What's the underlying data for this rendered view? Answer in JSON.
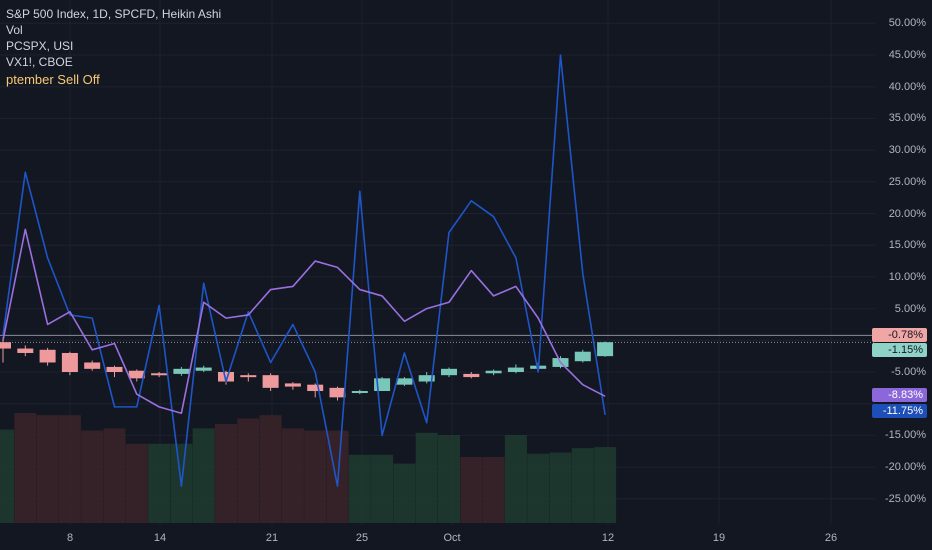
{
  "legend": {
    "title": "S&P 500 Index, 1D, SPCFD, Heikin Ashi",
    "vol": "Vol",
    "pcspx": "PCSPX, USI",
    "vx": "VX1!, CBOE",
    "annotation": "ptember Sell Off"
  },
  "colors": {
    "background": "#131722",
    "grid": "#1e2230",
    "up": "#79c7b9",
    "down": "#ee9a9c",
    "vx_line": "#1e55c8",
    "pcspx_line": "#9a6fe0",
    "pill_spx": "#f1a6a6",
    "pill_spx2": "#8fd3c6",
    "pill_pcspx": "#8b67d9",
    "pill_vx": "#1d4fb8"
  },
  "chart_data": {
    "type": "line",
    "x_labels": [
      "8",
      "14",
      "21",
      "25",
      "Oct",
      "12",
      "19",
      "26"
    ],
    "y_ticks": [
      "50.00%",
      "45.00%",
      "40.00%",
      "35.00%",
      "30.00%",
      "25.00%",
      "20.00%",
      "15.00%",
      "10.00%",
      "5.00%",
      "-5.00%",
      "-15.00%",
      "-20.00%",
      "-25.00%"
    ],
    "y_range": [
      -28,
      52
    ],
    "vx1_cboe": [
      0.8,
      26.5,
      13,
      4,
      3.5,
      -10.5,
      -10.5,
      5.5,
      -23,
      9,
      -6.5,
      4.5,
      -3.5,
      2.5,
      -5,
      -23,
      23.5,
      -15,
      -2,
      -13,
      17,
      22,
      19.5,
      13,
      -5,
      45,
      10.5,
      -11.75
    ],
    "pcspx_usi": [
      0,
      17.5,
      2.5,
      4.5,
      -1.5,
      -0.5,
      -8.5,
      -10.5,
      -11.5,
      6,
      3.5,
      4,
      8,
      8.5,
      12.5,
      11.5,
      8,
      7,
      3,
      5,
      6,
      11,
      7,
      8.5,
      3.5,
      -3.5,
      -7,
      -8.83
    ],
    "spx_candles": [
      {
        "o": -0.3,
        "c": -1.3,
        "h": 0.5,
        "l": -3.5
      },
      {
        "o": -1.3,
        "c": -2.0,
        "h": -0.8,
        "l": -2.5
      },
      {
        "o": -1.5,
        "c": -3.5,
        "h": -1.2,
        "l": -4.0
      },
      {
        "o": -2.0,
        "c": -5.0,
        "h": -1.8,
        "l": -5.5
      },
      {
        "o": -3.5,
        "c": -4.5,
        "h": -3.2,
        "l": -4.8
      },
      {
        "o": -4.2,
        "c": -5.0,
        "h": -4.0,
        "l": -5.8
      },
      {
        "o": -4.8,
        "c": -6.0,
        "h": -4.6,
        "l": -6.5
      },
      {
        "o": -5.2,
        "c": -5.5,
        "h": -5.0,
        "l": -5.8
      },
      {
        "o": -5.3,
        "c": -4.5,
        "h": -4.2,
        "l": -5.6
      },
      {
        "o": -4.8,
        "c": -4.3,
        "h": -4.0,
        "l": -5.0
      },
      {
        "o": -5.0,
        "c": -6.5,
        "h": -4.8,
        "l": -7.0
      },
      {
        "o": -5.5,
        "c": -5.8,
        "h": -5.2,
        "l": -6.5
      },
      {
        "o": -5.5,
        "c": -7.5,
        "h": -5.2,
        "l": -8.0
      },
      {
        "o": -6.8,
        "c": -7.3,
        "h": -6.6,
        "l": -7.8
      },
      {
        "o": -7.0,
        "c": -8.0,
        "h": -6.8,
        "l": -9.0
      },
      {
        "o": -7.5,
        "c": -9.0,
        "h": -7.3,
        "l": -9.5
      },
      {
        "o": -8.0,
        "c": -8.0,
        "h": -7.8,
        "l": -8.5
      },
      {
        "o": -8.0,
        "c": -6.0,
        "h": -5.8,
        "l": -8.0
      },
      {
        "o": -7.0,
        "c": -6.0,
        "h": -5.8,
        "l": -7.2
      },
      {
        "o": -6.5,
        "c": -5.5,
        "h": -5.0,
        "l": -6.8
      },
      {
        "o": -5.5,
        "c": -4.5,
        "h": -4.3,
        "l": -5.8
      },
      {
        "o": -5.3,
        "c": -5.8,
        "h": -5.0,
        "l": -6.0
      },
      {
        "o": -5.2,
        "c": -4.8,
        "h": -4.6,
        "l": -5.5
      },
      {
        "o": -5.0,
        "c": -4.3,
        "h": -3.8,
        "l": -5.2
      },
      {
        "o": -4.5,
        "c": -4.0,
        "h": -3.5,
        "l": -4.7
      },
      {
        "o": -4.2,
        "c": -2.8,
        "h": -2.5,
        "l": -4.4
      },
      {
        "o": -3.3,
        "c": -1.8,
        "h": -1.5,
        "l": -3.5
      },
      {
        "o": -2.5,
        "c": -0.3,
        "h": -0.2,
        "l": -2.6
      }
    ],
    "volume": [
      85,
      100,
      98,
      98,
      84,
      86,
      72,
      72,
      72,
      86,
      90,
      95,
      98,
      86,
      84,
      84,
      62,
      62,
      54,
      82,
      80,
      60,
      60,
      80,
      63,
      64,
      68,
      69
    ],
    "volume_up": [
      true,
      false,
      false,
      false,
      false,
      false,
      false,
      true,
      true,
      true,
      false,
      false,
      false,
      false,
      false,
      false,
      true,
      true,
      true,
      true,
      true,
      false,
      false,
      true,
      true,
      true,
      true,
      true
    ],
    "last_values": {
      "spx_high": "-0.78%",
      "spx": "-1.15%",
      "pcspx": "-8.83%",
      "vx": "-11.75%"
    }
  }
}
